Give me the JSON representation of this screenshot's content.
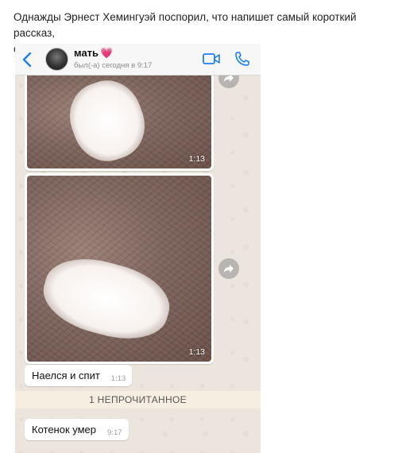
{
  "post": {
    "line1": "Однажды Эрнест Хемингуэй поспорил, что напишет самый короткий рассказ,",
    "line2": "способный растрогать любого"
  },
  "chat_header": {
    "contact_name": "мать",
    "contact_emoji": "💗",
    "last_seen": "был(-а) сегодня в 9:17",
    "icons": [
      "back-chevron-icon",
      "video-call-icon",
      "phone-call-icon"
    ],
    "accent_color": "#1d7ef5"
  },
  "messages": [
    {
      "type": "image",
      "time": "1:13",
      "description_icon": "forward-icon"
    },
    {
      "type": "image",
      "time": "1:13",
      "description_icon": "forward-icon"
    },
    {
      "type": "text",
      "text": "Наелся и спит",
      "time": "1:13"
    },
    {
      "type": "divider",
      "text": "1 НЕПРОЧИТАННОЕ"
    },
    {
      "type": "text",
      "text": "Котенок умер",
      "time": "9:17"
    }
  ],
  "colors": {
    "chat_background": "#ece5dd",
    "bubble": "#ffffff",
    "unread_bar": "#f6eee0"
  }
}
